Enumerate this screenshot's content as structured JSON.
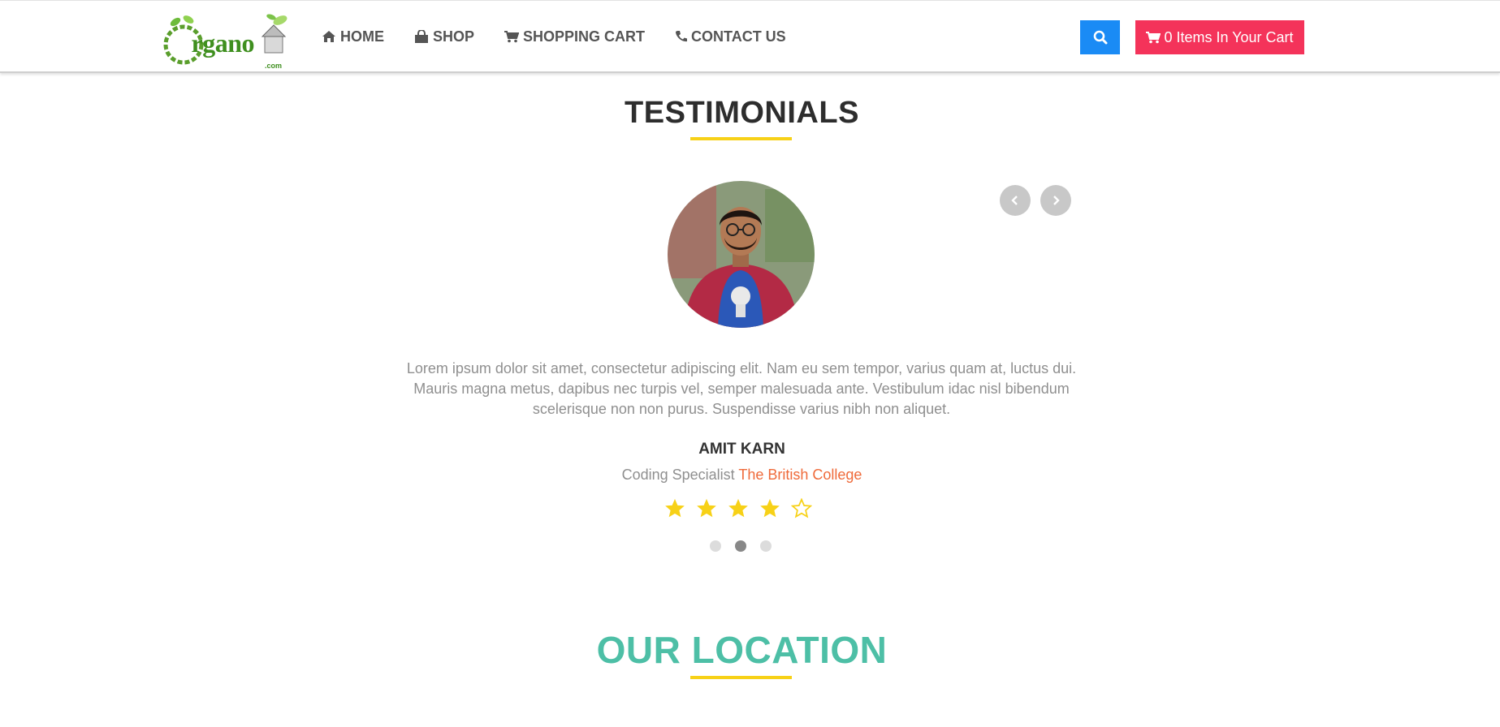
{
  "header": {
    "logo_text": "rgano",
    "logo_letter": "O",
    "logo_suffix": ".com",
    "nav": [
      {
        "label": "HOME",
        "icon": "home-icon"
      },
      {
        "label": "SHOP",
        "icon": "shopping-bag-icon"
      },
      {
        "label": "SHOPPING CART",
        "icon": "cart-icon"
      },
      {
        "label": "CONTACT US",
        "icon": "phone-icon"
      }
    ],
    "search_icon": "search-icon",
    "cart_button_label": "0 Items In Your Cart"
  },
  "testimonials": {
    "title": "TESTIMONIALS",
    "quote": "Lorem ipsum dolor sit amet, consectetur adipiscing elit. Nam eu sem tempor, varius quam at, luctus dui. Mauris magna metus, dapibus nec turpis vel, semper malesuada ante. Vestibulum idac nisl bibendum scelerisque non non purus. Suspendisse varius nibh non aliquet.",
    "name": "AMIT KARN",
    "role": "Coding Specialist",
    "organization": "The British College",
    "rating": 4,
    "rating_max": 5,
    "slide_count": 3,
    "active_slide": 2
  },
  "location": {
    "title": "OUR LOCATION"
  },
  "colors": {
    "accent_yellow": "#f7d117",
    "search_blue": "#1a8bf5",
    "cart_pink": "#f4335a",
    "location_teal": "#4dbfa6",
    "org_orange": "#ef6a3a"
  }
}
